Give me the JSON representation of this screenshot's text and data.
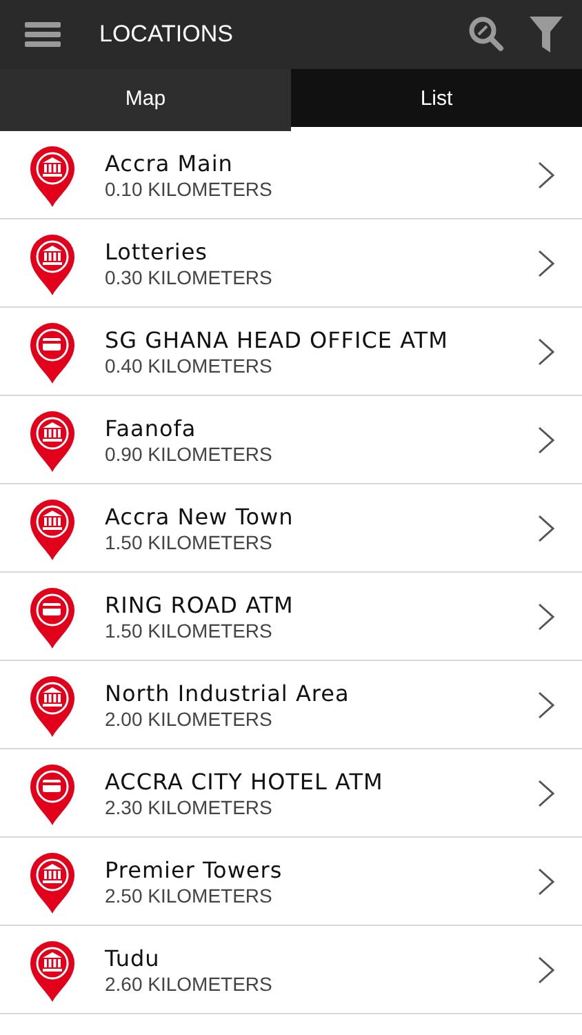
{
  "header": {
    "title": "LOCATIONS"
  },
  "tabs": [
    {
      "label": "Map",
      "selected": false
    },
    {
      "label": "List",
      "selected": true
    }
  ],
  "locations": [
    {
      "kind": "branch",
      "name": "Accra Main",
      "distance": "0.10 KILOMETERS"
    },
    {
      "kind": "branch",
      "name": "Lotteries",
      "distance": "0.30 KILOMETERS"
    },
    {
      "kind": "atm",
      "name": "SG GHANA HEAD OFFICE ATM",
      "distance": "0.40 KILOMETERS"
    },
    {
      "kind": "branch",
      "name": "Faanofa",
      "distance": "0.90 KILOMETERS"
    },
    {
      "kind": "branch",
      "name": "Accra New Town",
      "distance": "1.50 KILOMETERS"
    },
    {
      "kind": "atm",
      "name": "RING ROAD ATM",
      "distance": "1.50 KILOMETERS"
    },
    {
      "kind": "branch",
      "name": "North Industrial Area",
      "distance": "2.00 KILOMETERS"
    },
    {
      "kind": "atm",
      "name": "ACCRA CITY HOTEL ATM",
      "distance": "2.30 KILOMETERS"
    },
    {
      "kind": "branch",
      "name": "Premier Towers",
      "distance": "2.50 KILOMETERS"
    },
    {
      "kind": "branch",
      "name": "Tudu",
      "distance": "2.60 KILOMETERS"
    }
  ]
}
